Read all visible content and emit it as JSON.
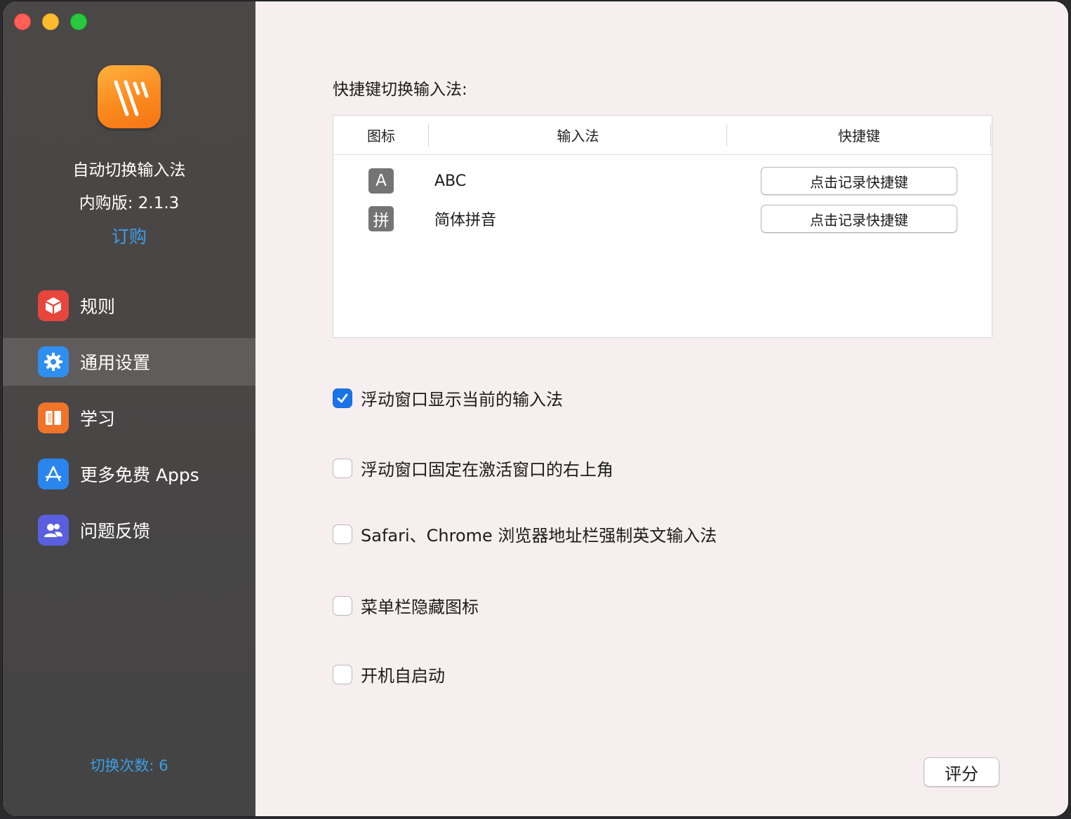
{
  "sidebar": {
    "app_name": "自动切换输入法",
    "version": "内购版: 2.1.3",
    "subscribe": "订购",
    "items": [
      {
        "label": "规则",
        "icon": "cube-icon",
        "color": "#e8453c"
      },
      {
        "label": "通用设置",
        "icon": "gear-icon",
        "color": "#2f8ff0"
      },
      {
        "label": "学习",
        "icon": "book-icon",
        "color": "#f0742a"
      },
      {
        "label": "更多免费 Apps",
        "icon": "app-store-icon",
        "color": "#2a86ee"
      },
      {
        "label": "问题反馈",
        "icon": "people-icon",
        "color": "#5a5fe0"
      }
    ],
    "active_index": 1,
    "switch_count": "切换次数: 6"
  },
  "main": {
    "section_title": "快捷键切换输入法:",
    "table": {
      "headers": [
        "图标",
        "输入法",
        "快捷键"
      ],
      "rows": [
        {
          "icon_glyph": "A",
          "name": "ABC",
          "shortcut_label": "点击记录快捷键"
        },
        {
          "icon_glyph": "拼",
          "name": "简体拼音",
          "shortcut_label": "点击记录快捷键"
        }
      ]
    },
    "options": [
      {
        "label": "浮动窗口显示当前的输入法",
        "checked": true
      },
      {
        "label": "浮动窗口固定在激活窗口的右上角",
        "checked": false
      },
      {
        "label": "Safari、Chrome 浏览器地址栏强制英文输入法",
        "checked": false
      },
      {
        "label": "菜单栏隐藏图标",
        "checked": false
      },
      {
        "label": "开机自启动",
        "checked": false
      }
    ],
    "rate_label": "评分"
  },
  "colors": {
    "accent": "#1a74e8",
    "link": "#3b9fe6",
    "close": "#fe5f57",
    "minimize": "#febc2e",
    "zoom": "#28c840"
  }
}
